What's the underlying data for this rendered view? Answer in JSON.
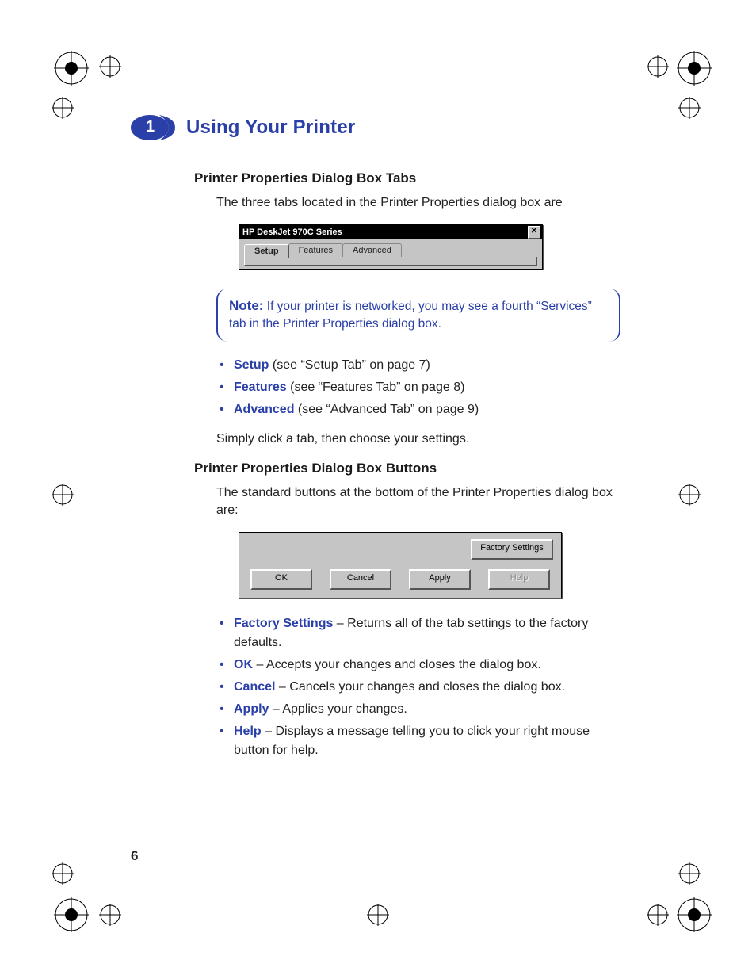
{
  "chapter": {
    "number": "1",
    "title": "Using Your Printer"
  },
  "section_tabs": {
    "heading": "Printer Properties Dialog Box Tabs",
    "intro": "The three tabs located in the Printer Properties dialog box are",
    "dialog": {
      "title": "HP DeskJet 970C Series",
      "close_glyph": "✕",
      "tabs": [
        "Setup",
        "Features",
        "Advanced"
      ]
    },
    "note": {
      "label": "Note:",
      "text": "If your printer is networked, you may see a fourth “Services” tab in the Printer Properties dialog box."
    },
    "list": [
      {
        "term": "Setup",
        "rest": " (see “Setup Tab” on page 7)"
      },
      {
        "term": "Features",
        "rest": " (see “Features Tab” on page 8)"
      },
      {
        "term": "Advanced",
        "rest": " (see “Advanced Tab” on page 9)"
      }
    ],
    "closing": "Simply click a tab, then choose your settings."
  },
  "section_buttons": {
    "heading": "Printer Properties Dialog Box Buttons",
    "intro": "The standard buttons at the bottom of the Printer Properties dialog box are:",
    "buttons": {
      "factory": "Factory Settings",
      "ok": "OK",
      "cancel": "Cancel",
      "apply": "Apply",
      "help": "Help"
    },
    "list": [
      {
        "term": "Factory Settings",
        "rest": " – Returns all of the tab settings to the factory defaults."
      },
      {
        "term": "OK",
        "rest": " – Accepts your changes and closes the dialog box."
      },
      {
        "term": "Cancel",
        "rest": " – Cancels your changes and closes the dialog box."
      },
      {
        "term": "Apply",
        "rest": " – Applies your changes."
      },
      {
        "term": "Help",
        "rest": " – Displays a message telling you to click your right mouse button for help."
      }
    ]
  },
  "page_number": "6"
}
